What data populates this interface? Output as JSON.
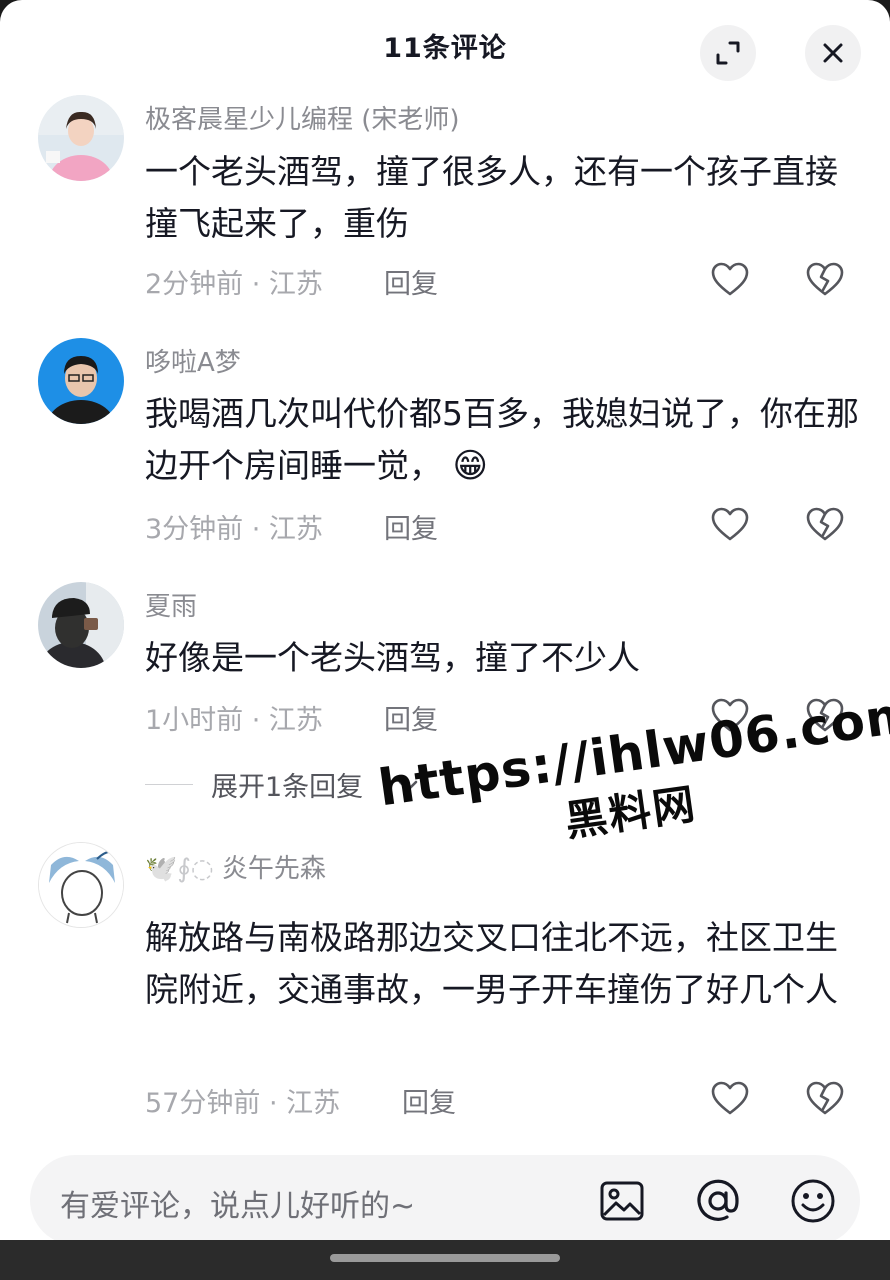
{
  "header": {
    "title": "11条评论"
  },
  "comments": [
    {
      "username": "极客晨星少儿编程 (宋老师)",
      "text": "一个老头酒驾，撞了很多人，还有一个孩子直接撞飞起来了，重伤",
      "meta": "2分钟前 · 江苏",
      "reply": "回复"
    },
    {
      "username": "哆啦A梦",
      "text": "我喝酒几次叫代价都5百多，我媳妇说了，你在那边开个房间睡一觉，",
      "emoji": "😁",
      "meta": "3分钟前 · 江苏",
      "reply": "回复"
    },
    {
      "username": "夏雨",
      "text": "好像是一个老头酒驾，撞了不少人",
      "meta": "1小时前 · 江苏",
      "reply": "回复",
      "expand": "展开1条回复"
    },
    {
      "username_prefix": "🕊️∮◌",
      "username": "炎午先森",
      "text": "解放路与南极路那边交叉口往北不远，社区卫生院附近，交通事故，一男子开车撞伤了好几个人",
      "meta": "57分钟前 · 江苏",
      "reply": "回复"
    }
  ],
  "watermark": {
    "url": "https://ihlw06.com",
    "name": "黑料网"
  },
  "input": {
    "placeholder": "有爱评论，说点儿好听的~"
  },
  "icons": {
    "expand": "expand-icon",
    "close": "close-icon",
    "like": "heart-icon",
    "dislike": "broken-heart-icon",
    "image": "image-icon",
    "at": "at-icon",
    "emoji": "emoji-icon"
  }
}
